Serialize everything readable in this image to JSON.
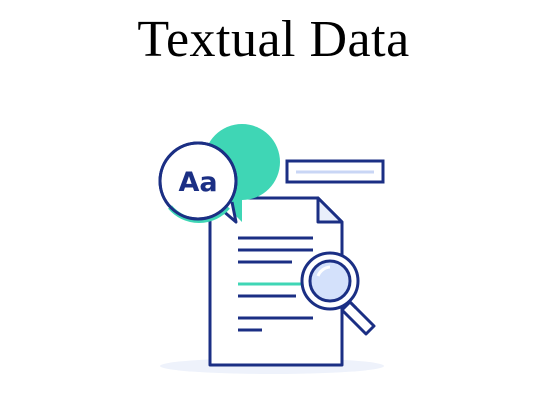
{
  "title": "Textual Data",
  "speech_bubble": {
    "text": "Aa"
  },
  "icons": {
    "bubble": "speech-bubble-icon",
    "document": "document-icon",
    "magnifier": "magnifying-glass-icon",
    "label_bar": "label-bar-icon"
  },
  "colors": {
    "outline": "#1b2f84",
    "accent": "#3fd6b5",
    "light_fill": "#e9effb",
    "lens_fill": "#d4e1fb",
    "shadow": "#eef2fb"
  }
}
